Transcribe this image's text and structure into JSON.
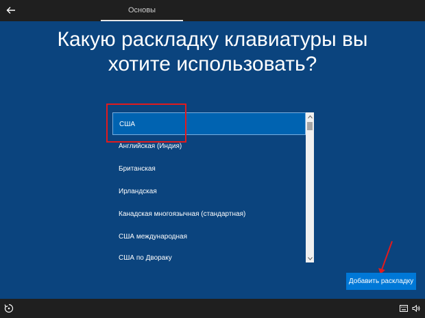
{
  "header": {
    "tab_label": "Основы"
  },
  "title": "Какую раскладку клавиатуры вы хотите использовать?",
  "layouts": {
    "selected_index": 0,
    "items": [
      "США",
      "Английская (Индия)",
      "Британская",
      "Ирландская",
      "Канадская многоязычная (стандартная)",
      "США международная",
      "США по Двораку"
    ]
  },
  "actions": {
    "add_layout_label": "Добавить раскладку"
  },
  "icons": {
    "back": "back-arrow-icon",
    "ease_of_access": "ease-of-access-icon",
    "keyboard": "keyboard-icon",
    "volume": "volume-icon"
  },
  "colors": {
    "background": "#0b447e",
    "bars": "#1f1f1f",
    "selection": "#0063b1",
    "button": "#0078d7",
    "annotation": "#e31a1c"
  }
}
